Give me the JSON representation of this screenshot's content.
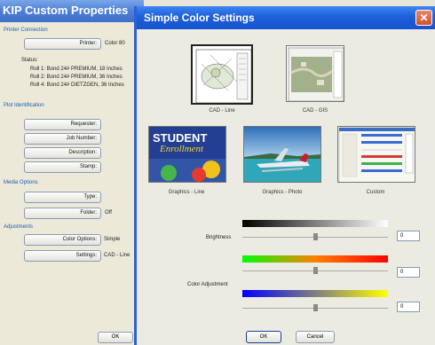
{
  "background_window": {
    "title": "KIP Custom Properties",
    "printer_connection": {
      "section": "Printer Connection",
      "printer_button": "Printer:",
      "printer_value": "Color 80",
      "status_label": "Status:",
      "rolls": [
        "Roll 1: Bond 24# PREMIUM, 18 Inches",
        "Roll 2: Bond 24# PREMIUM, 36 Inches",
        "Roll 4: Bond 24# DIETZGEN, 36 Inches"
      ]
    },
    "plot_identification": {
      "section": "Plot Identification",
      "buttons": [
        "Requester:",
        "Job Number:",
        "Description:",
        "Stamp:"
      ]
    },
    "media_options": {
      "section": "Media Options",
      "type_button": "Type:",
      "folder_button": "Folder:",
      "folder_value": "Off"
    },
    "adjustments": {
      "section": "Adjustments",
      "color_options_button": "Color Options:",
      "color_options_value": "Simple",
      "settings_button": "Settings:",
      "settings_value": "CAD - Line"
    },
    "ok_button": "OK"
  },
  "dialog": {
    "title": "Simple Color Settings",
    "presets": [
      {
        "label": "CAD - Line",
        "selected": true
      },
      {
        "label": "CAD - GIS",
        "selected": false
      },
      {
        "label": "Graphics - Line",
        "selected": false,
        "image_text": [
          "STUDENT",
          "Enrollment"
        ]
      },
      {
        "label": "Graphics - Photo",
        "selected": false
      },
      {
        "label": "Custom",
        "selected": false
      }
    ],
    "brightness": {
      "label": "Brightness",
      "value": "0",
      "level": 0.5
    },
    "color_adjustment": {
      "label": "Color Adjustment",
      "slider1_value": "0",
      "slider1_level": 0.5,
      "slider2_value": "0",
      "slider2_level": 0.5
    },
    "ok_button": "OK",
    "cancel_button": "Cancel"
  },
  "colors": {
    "titlebar_blue": "#1f5fd9",
    "section_blue": "#1c5bb8",
    "close_red": "#d5502c"
  }
}
